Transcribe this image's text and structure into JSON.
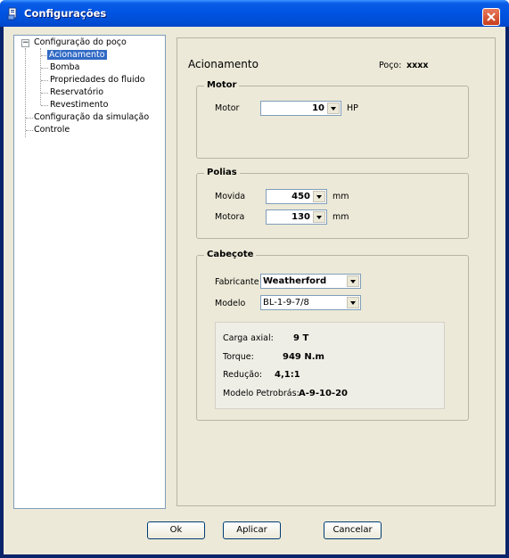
{
  "window": {
    "title": "Configurações"
  },
  "tree": {
    "items": [
      {
        "label": "Configuração do poço"
      },
      {
        "label": "Acionamento"
      },
      {
        "label": "Bomba"
      },
      {
        "label": "Propriedades do fluido"
      },
      {
        "label": "Reservatório"
      },
      {
        "label": "Revestimento"
      },
      {
        "label": "Configuração da simulação"
      },
      {
        "label": "Controle"
      }
    ],
    "expander_symbol": "−"
  },
  "panel": {
    "heading": "Acionamento",
    "poco_label": "Poço:",
    "poco_value": "xxxx",
    "motor": {
      "title": "Motor",
      "label": "Motor",
      "value": "10",
      "unit": "HP"
    },
    "polias": {
      "title": "Polias",
      "movida_label": "Movida",
      "movida_value": "450",
      "movida_unit": "mm",
      "motora_label": "Motora",
      "motora_value": "130",
      "motora_unit": "mm"
    },
    "cabecote": {
      "title": "Cabeçote",
      "fabricante_label": "Fabricante",
      "fabricante_value": "Weatherford",
      "modelo_label": "Modelo",
      "modelo_value": "BL-1-9-7/8",
      "info": {
        "carga_label": "Carga axial:",
        "carga_value": "9 T",
        "torque_label": "Torque:",
        "torque_value": "949 N.m",
        "reducao_label": "Redução:",
        "reducao_value": "4,1:1",
        "petrobras_label": "Modelo Petrobrás:",
        "petrobras_value": "A-9-10-20"
      }
    }
  },
  "buttons": {
    "ok": "Ok",
    "apply": "Aplicar",
    "cancel": "Cancelar"
  },
  "colors": {
    "titlebar": "#0054e3",
    "selection": "#316ac5",
    "close": "#c73d1a",
    "dialog_bg": "#ece9d8"
  }
}
